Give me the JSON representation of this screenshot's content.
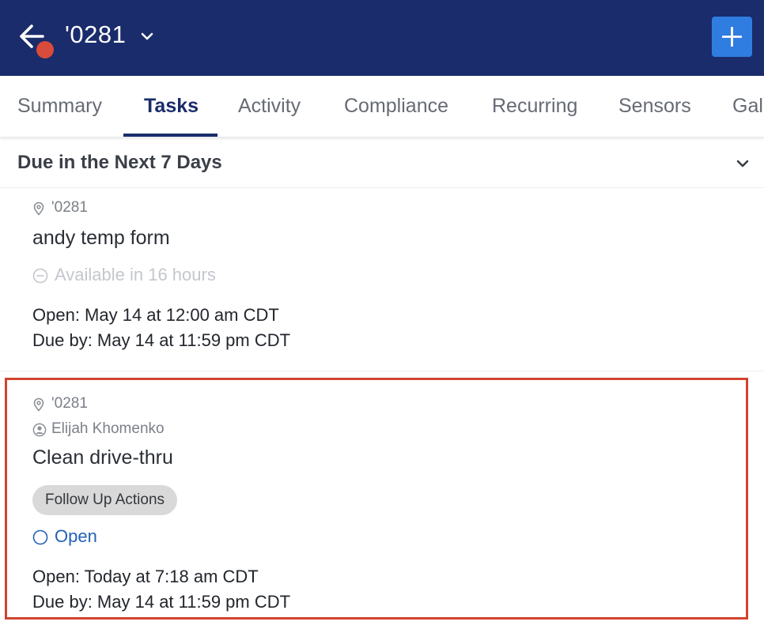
{
  "header": {
    "store_name": "'0281",
    "colors": {
      "bar": "#1a2c6b",
      "add_button": "#2f7de1",
      "notification_dot": "#d94b3a"
    }
  },
  "tabs": [
    {
      "label": "Summary"
    },
    {
      "label": "Tasks"
    },
    {
      "label": "Activity"
    },
    {
      "label": "Compliance"
    },
    {
      "label": "Recurring"
    },
    {
      "label": "Sensors"
    },
    {
      "label": "Gall"
    }
  ],
  "section": {
    "title": "Due in the Next 7 Days"
  },
  "tasks": [
    {
      "location": "'0281",
      "title": "andy temp form",
      "status": "Available in 16 hours",
      "open_time": "Open: May 14 at 12:00 am CDT",
      "due_time": "Due by: May 14 at 11:59 pm CDT"
    },
    {
      "location": "'0281",
      "assignee": "Elijah Khomenko",
      "title": "Clean drive-thru",
      "tag": "Follow Up Actions",
      "status": "Open",
      "open_time": "Open: Today at 7:18 am CDT",
      "due_time": "Due by: May 14 at 11:59 pm CDT"
    }
  ]
}
